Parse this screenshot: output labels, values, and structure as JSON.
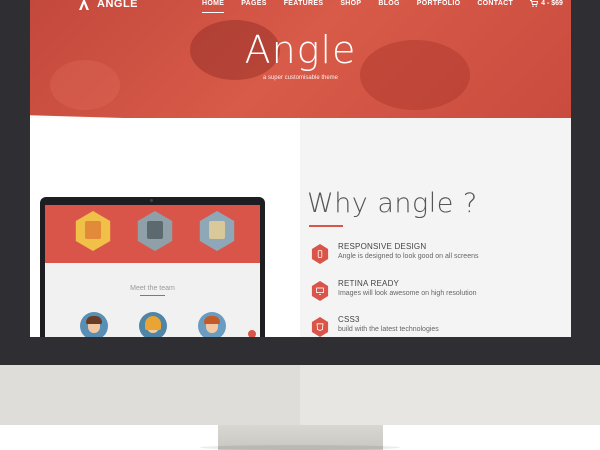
{
  "brand": {
    "name": "ANGLE"
  },
  "nav": {
    "items": [
      {
        "label": "HOME",
        "active": true
      },
      {
        "label": "PAGES",
        "active": false
      },
      {
        "label": "FEATURES",
        "active": false
      },
      {
        "label": "SHOP",
        "active": false
      },
      {
        "label": "BLOG",
        "active": false
      },
      {
        "label": "PORTFOLIO",
        "active": false
      },
      {
        "label": "CONTACT",
        "active": false
      }
    ],
    "cart": {
      "icon": "cart-icon",
      "label": "4 - $69"
    }
  },
  "hero": {
    "title": "Angle",
    "subtitle": "a super customisable theme"
  },
  "laptop_preview": {
    "meet_label": "Meet the team"
  },
  "why": {
    "title": "Why angle ?",
    "features": [
      {
        "icon": "mobile-icon",
        "title": "RESPONSIVE DESIGN",
        "desc": "Angle is designed to look good on all screens"
      },
      {
        "icon": "monitor-icon",
        "title": "RETINA READY",
        "desc": "Images will look awesome on high resolution"
      },
      {
        "icon": "css3-icon",
        "title": "CSS3",
        "desc": "build with the latest technologies"
      }
    ]
  },
  "colors": {
    "accent": "#d9554a",
    "bezel": "#2f2f33",
    "chin": "#e8e6e2"
  }
}
